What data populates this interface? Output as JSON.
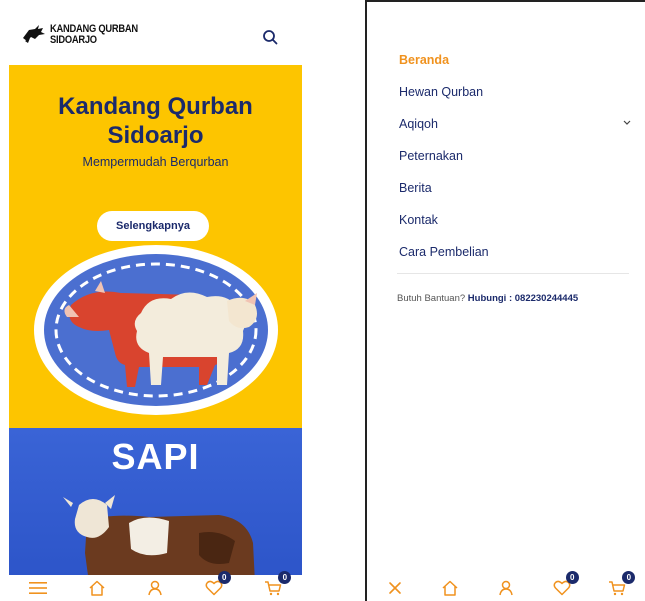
{
  "left": {
    "brand": {
      "line1": "KANDANG QURBAN",
      "line2": "SIDOARJO"
    },
    "hero": {
      "title_line1": "Kandang Qurban",
      "title_line2": "Sidoarjo",
      "subtitle": "Mempermudah Berqurban",
      "button": "Selengkapnya"
    },
    "banner_title": "SAPI",
    "nav": {
      "wishlist_count": "0",
      "cart_count": "0"
    }
  },
  "right": {
    "menu": [
      {
        "label": "Beranda"
      },
      {
        "label": "Hewan Qurban"
      },
      {
        "label": "Aqiqoh"
      },
      {
        "label": "Peternakan"
      },
      {
        "label": "Berita"
      },
      {
        "label": "Kontak"
      },
      {
        "label": "Cara Pembelian"
      }
    ],
    "help_prefix": "Butuh Bantuan?",
    "help_contact": "Hubungi : 082230244445",
    "nav": {
      "wishlist_count": "0",
      "cart_count": "0"
    }
  },
  "colors": {
    "hero_bg": "#fdc500",
    "navy": "#1b2a6b",
    "accent": "#f0921e",
    "banner_blue": "#3a64d6"
  },
  "icons": [
    "search-icon",
    "menu-icon",
    "home-icon",
    "user-icon",
    "heart-icon",
    "cart-icon",
    "close-icon",
    "chevron-down-icon"
  ]
}
